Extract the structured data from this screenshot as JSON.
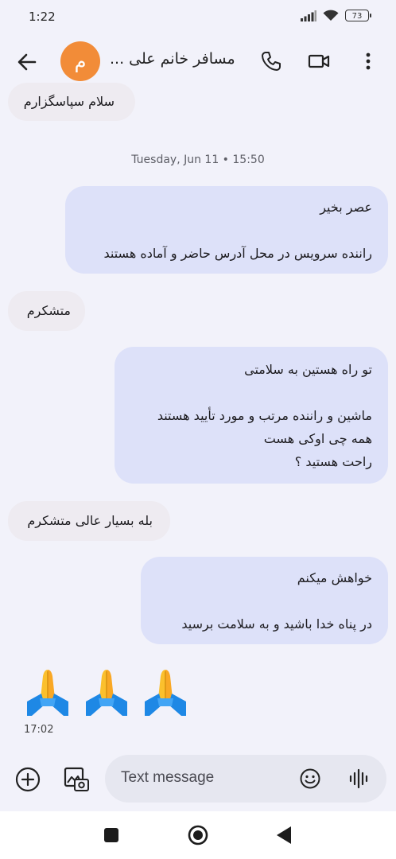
{
  "status_bar": {
    "time": "1:22",
    "battery": "73"
  },
  "app_bar": {
    "avatar_initial": "م",
    "contact_name": "مسافر خانم علی ..."
  },
  "messages": [
    {
      "direction": "incoming",
      "lines": [
        "سلام سپاسگزارم"
      ]
    },
    {
      "direction": "outgoing",
      "lines": [
        "عصر بخیر",
        "",
        "راننده سرویس در محل آدرس حاضر و آماده هستند"
      ]
    },
    {
      "direction": "incoming",
      "lines": [
        "متشکرم"
      ]
    },
    {
      "direction": "outgoing",
      "lines": [
        "تو راه هستین به سلامتی",
        "",
        "ماشین و راننده مرتب و مورد تأیید هستند",
        "همه چی اوکی هست",
        "راحت هستید ؟"
      ]
    },
    {
      "direction": "incoming",
      "lines": [
        "بله بسیار عالی متشکرم"
      ]
    },
    {
      "direction": "outgoing",
      "lines": [
        "خواهش میکنم",
        "",
        "در پناه خدا باشید و به سلامت برسید"
      ]
    },
    {
      "direction": "incoming",
      "emojis": [
        "🙏",
        "🙏",
        "🙏"
      ],
      "time": "17:02"
    }
  ],
  "timestamp_divider": "Tuesday, Jun 11 • 15:50",
  "compose": {
    "placeholder": "Text message"
  },
  "icons": {
    "back": "arrow-left-icon",
    "call": "phone-icon",
    "video": "video-camera-icon",
    "menu": "more-vert-icon",
    "add": "add-circle-icon",
    "gallery": "photo-camera-icon",
    "emoji": "emoji-smile-icon",
    "voice": "voice-wave-icon",
    "nav_recents": "square-icon",
    "nav_home": "circle-icon",
    "nav_back": "triangle-back-icon"
  },
  "colors": {
    "avatar": "#f28c38",
    "incoming_bubble": "#eeebf1",
    "outgoing_bubble": "#dde1f9",
    "background": "#f2f2fa"
  }
}
